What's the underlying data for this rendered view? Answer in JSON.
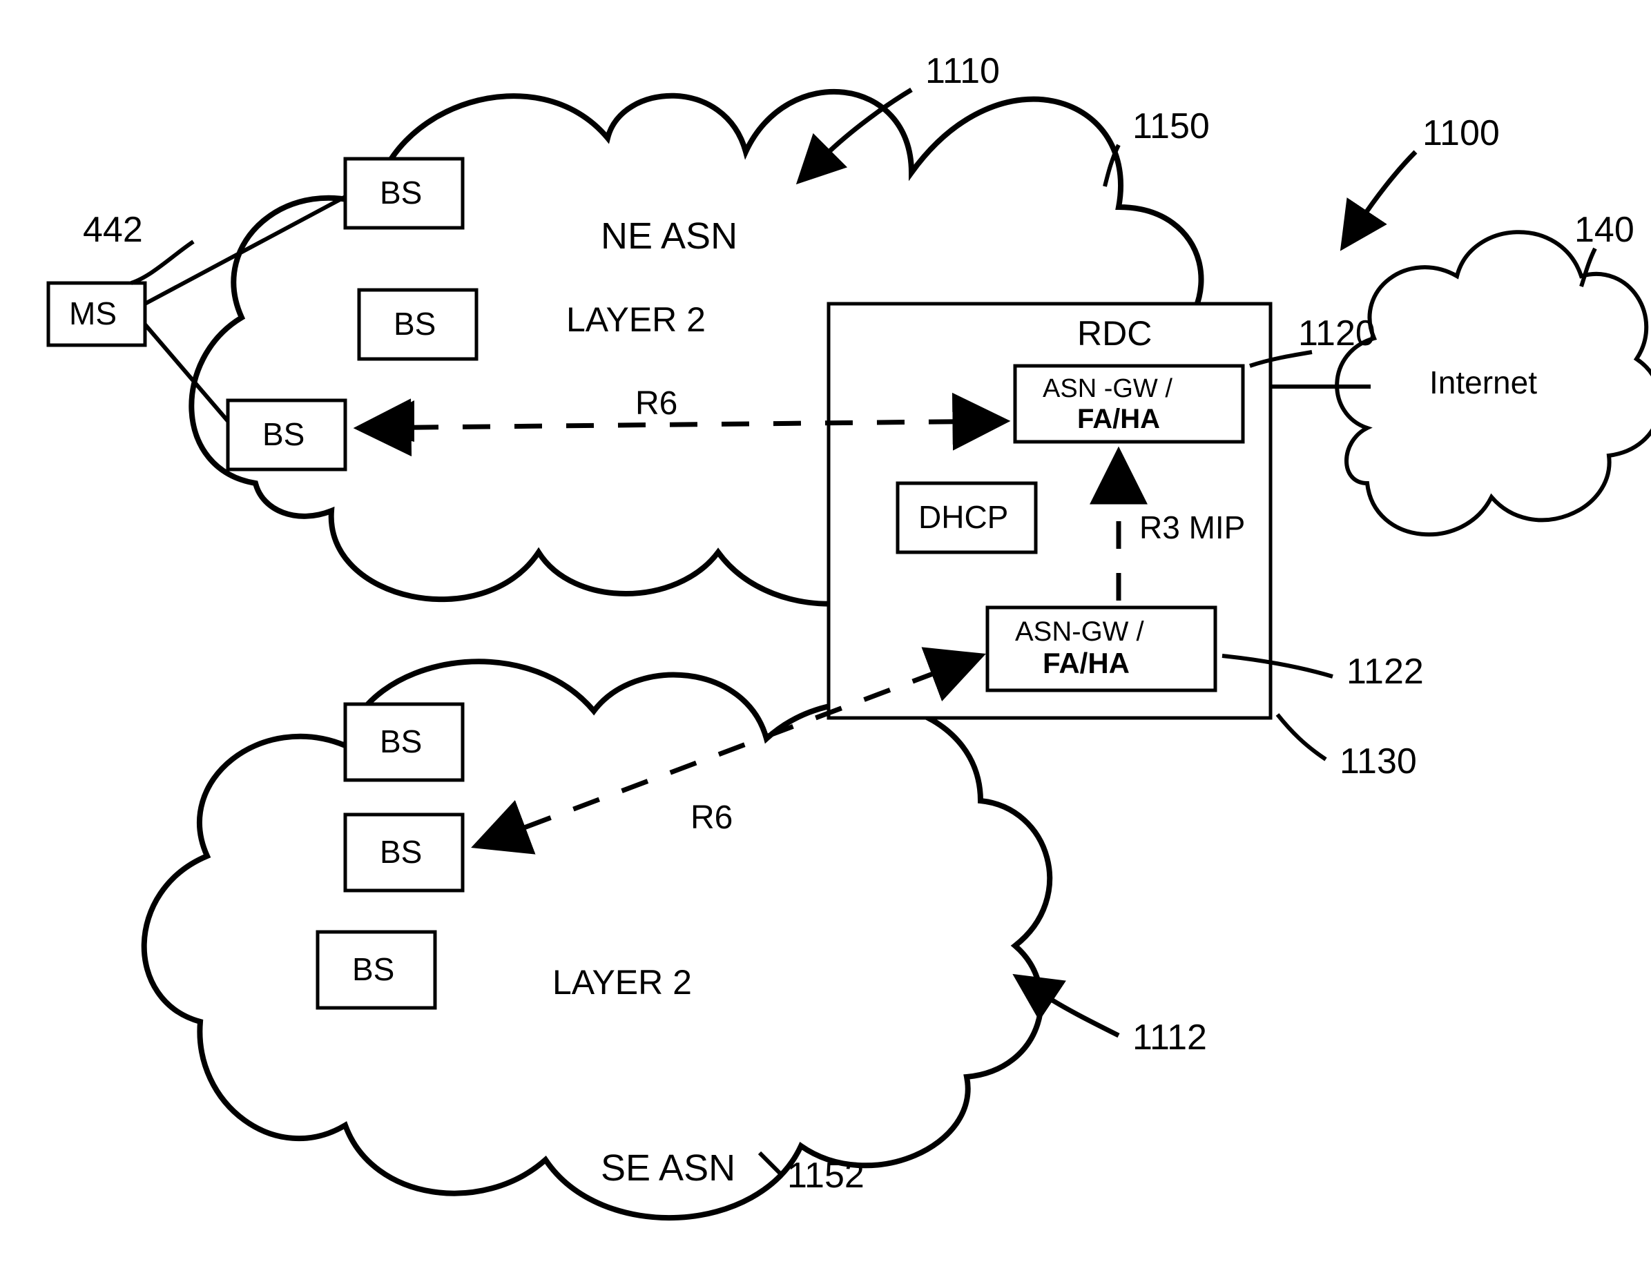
{
  "nodes": {
    "ms": "MS",
    "bs": "BS",
    "rdc": "RDC",
    "asn_gw": "ASN -GW /",
    "asn_gw2": "ASN-GW /",
    "fa_ha": "FA/HA",
    "dhcp": "DHCP",
    "internet": "Internet"
  },
  "regions": {
    "ne_asn": "NE ASN",
    "se_asn": "SE ASN",
    "layer2": "LAYER 2"
  },
  "links": {
    "r6": "R6",
    "r3_mip": "R3 MIP"
  },
  "refs": {
    "r442": "442",
    "r140": "140",
    "r1100": "1100",
    "r1110": "1110",
    "r1112": "1112",
    "r1120": "1120",
    "r1122": "1122",
    "r1130": "1130",
    "r1150": "1150",
    "r1152": "1152"
  }
}
